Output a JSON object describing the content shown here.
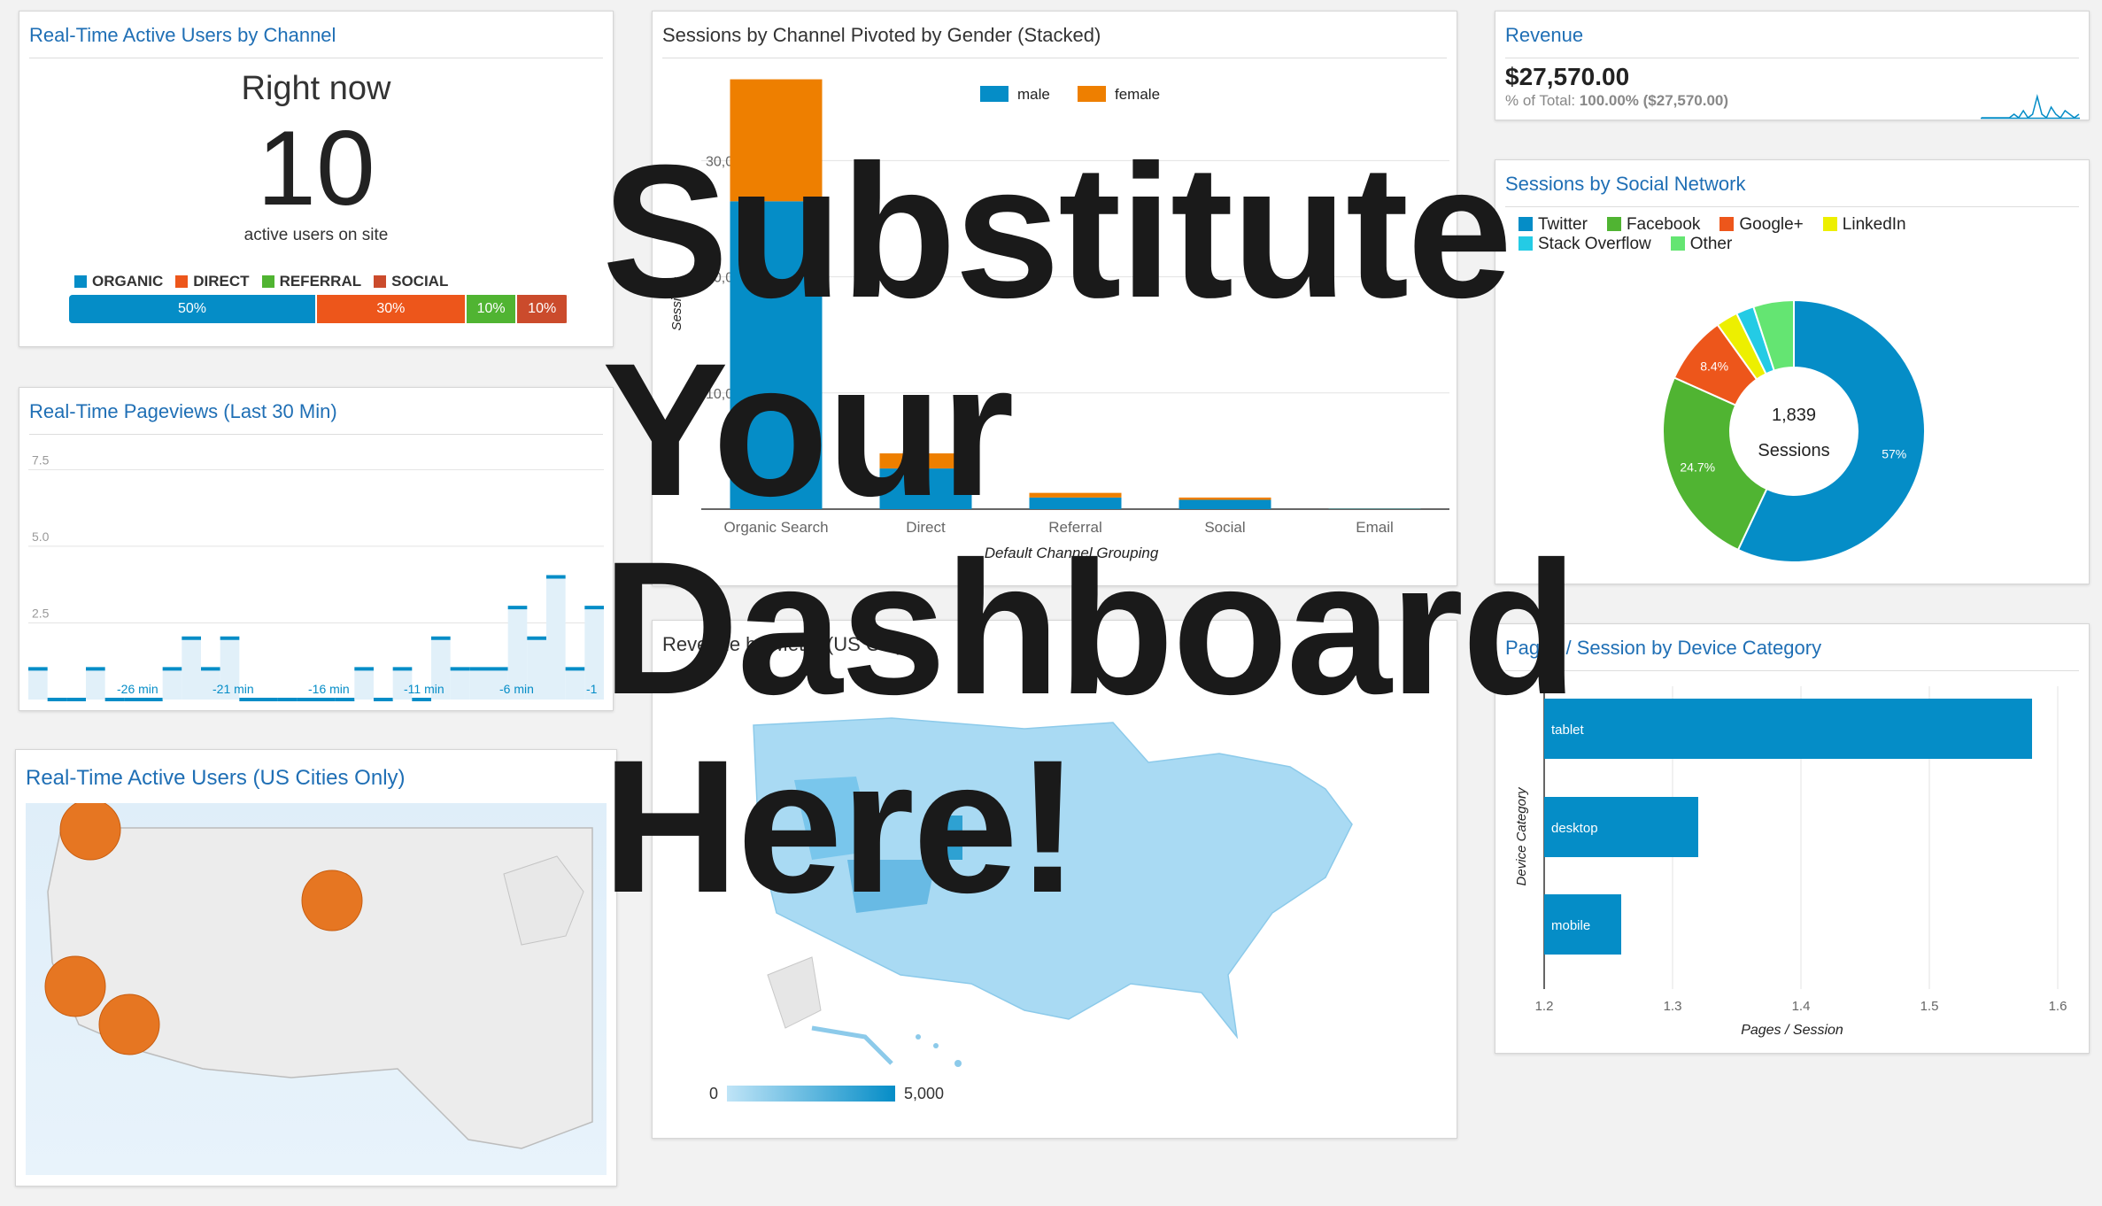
{
  "overlay": {
    "line1": "Substitute",
    "line2": "Your",
    "line3": "Dashboard",
    "line4": "Here!"
  },
  "realtime_channel": {
    "title": "Real-Time Active Users by Channel",
    "heading": "Right now",
    "count": "10",
    "caption": "active users on site",
    "legend": [
      {
        "label": "ORGANIC",
        "color": "#058dc7"
      },
      {
        "label": "DIRECT",
        "color": "#ed561b"
      },
      {
        "label": "REFERRAL",
        "color": "#50b432"
      },
      {
        "label": "SOCIAL",
        "color": "#cb4b2c"
      }
    ],
    "bar": [
      {
        "label": "50%",
        "value": 50,
        "color": "#058dc7"
      },
      {
        "label": "30%",
        "value": 30,
        "color": "#ed561b"
      },
      {
        "label": "10%",
        "value": 10,
        "color": "#50b432"
      },
      {
        "label": "10%",
        "value": 10,
        "color": "#cb4b2c"
      }
    ]
  },
  "pageviews": {
    "title": "Real-Time Pageviews (Last 30 Min)",
    "chart_data": {
      "type": "bar",
      "y_ticks": [
        "7.5",
        "5.0",
        "2.5"
      ],
      "ylim": [
        0,
        8
      ],
      "x_labels": [
        "-26 min",
        "-21 min",
        "-16 min",
        "-11 min",
        "-6 min",
        "-1"
      ],
      "values": [
        1,
        0,
        0,
        1,
        0,
        0,
        0,
        1,
        2,
        1,
        2,
        0,
        0,
        0,
        0,
        0,
        0,
        1,
        0,
        1,
        0,
        2,
        1,
        1,
        1,
        3,
        2,
        4,
        1,
        3
      ]
    }
  },
  "us_cities": {
    "title": "Real-Time Active Users (US Cities Only)",
    "bubble_color": "#e67622"
  },
  "stacked": {
    "title": "Sessions by Channel Pivoted by Gender (Stacked)",
    "chart_data": {
      "type": "bar",
      "categories": [
        "Organic Search",
        "Direct",
        "Referral",
        "Social",
        "Email"
      ],
      "series": [
        {
          "name": "male",
          "values": [
            26500,
            3500,
            1000,
            800,
            50
          ],
          "color": "#058dc7"
        },
        {
          "name": "female",
          "values": [
            10500,
            1300,
            400,
            200,
            20
          ],
          "color": "#ee7f00"
        }
      ],
      "y_ticks": [
        "30,000",
        "20,000",
        "10,000"
      ],
      "ylim": [
        0,
        37500
      ],
      "ylabel": "Sessions",
      "xlabel": "Default Channel Grouping"
    }
  },
  "revenue_map": {
    "title": "Revenue by Metro (US Only)",
    "legend_min": "0",
    "legend_max": "5,000"
  },
  "revenue": {
    "title": "Revenue",
    "value": "$27,570.00",
    "sub_prefix": "% of Total: ",
    "sub_bold": "100.00%",
    "sub_suffix": " ($27,570.00)",
    "spark": [
      0,
      0,
      0,
      0,
      0,
      0,
      0,
      1,
      0,
      2,
      0,
      1,
      6,
      1,
      0,
      3,
      1,
      0,
      2,
      1,
      0,
      1
    ]
  },
  "social": {
    "title": "Sessions by Social Network",
    "center_value": "1,839",
    "center_label": "Sessions",
    "chart_data": {
      "type": "pie",
      "slices": [
        {
          "name": "Twitter",
          "value": 57,
          "label": "57%",
          "color": "#058dc7"
        },
        {
          "name": "Facebook",
          "value": 24.7,
          "label": "24.7%",
          "color": "#50b432"
        },
        {
          "name": "Google+",
          "value": 8.4,
          "label": "8.4%",
          "color": "#ed561b"
        },
        {
          "name": "LinkedIn",
          "value": 2.7,
          "label": "",
          "color": "#edef00"
        },
        {
          "name": "Stack Overflow",
          "value": 2.2,
          "label": "",
          "color": "#24cbe5"
        },
        {
          "name": "Other",
          "value": 5.0,
          "label": "",
          "color": "#64e572"
        }
      ]
    }
  },
  "device": {
    "title": "Pages / Session by Device Category",
    "chart_data": {
      "type": "bar",
      "categories": [
        "tablet",
        "desktop",
        "mobile"
      ],
      "values": [
        1.58,
        1.32,
        1.26
      ],
      "xlim": [
        1.2,
        1.6
      ],
      "x_ticks": [
        "1.2",
        "1.3",
        "1.4",
        "1.5",
        "1.6"
      ],
      "xlabel": "Pages / Session",
      "ylabel": "Device Category",
      "color": "#058dc7"
    }
  }
}
